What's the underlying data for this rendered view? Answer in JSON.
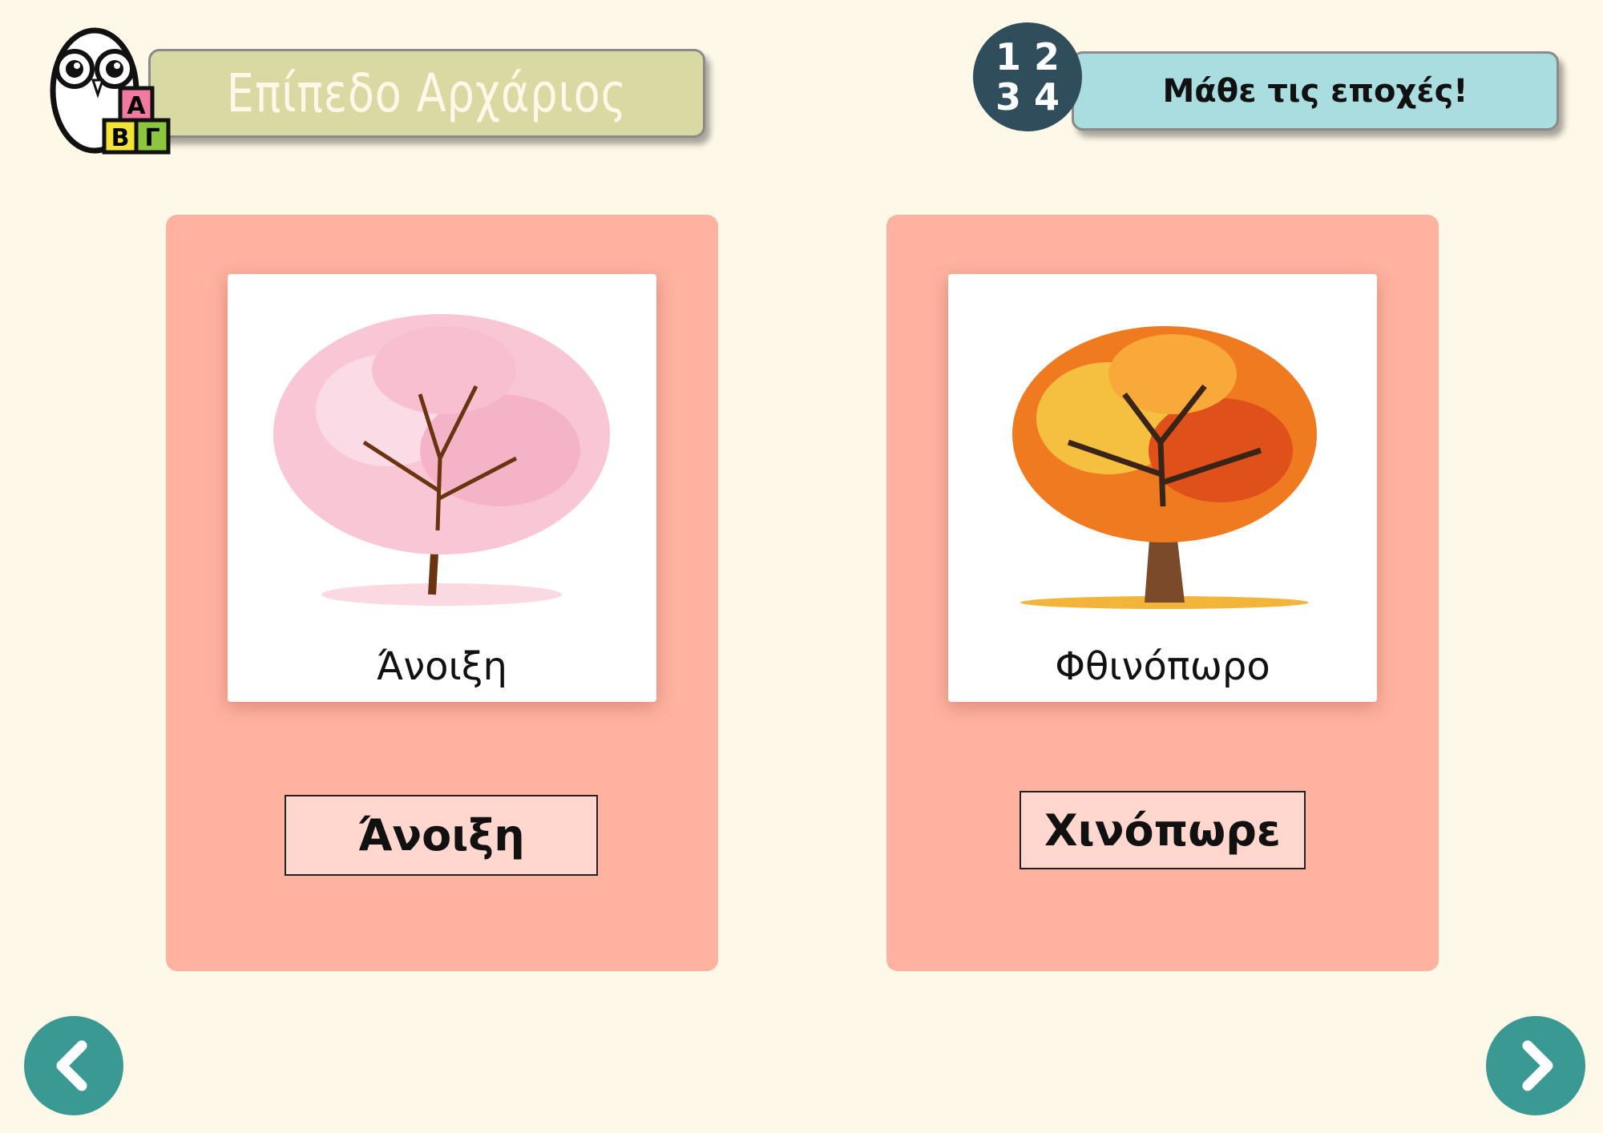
{
  "header": {
    "level_label": "Επίπεδο Αρχάριος",
    "logo_letters": [
      "A",
      "B",
      "Γ"
    ],
    "number_badge": [
      "1 2",
      "3 4"
    ],
    "activity_title": "Μάθε τις εποχές!"
  },
  "cards": [
    {
      "image": "cherry-blossom-tree",
      "image_label": "Άνοιξη",
      "answer": "Άνοιξη"
    },
    {
      "image": "autumn-tree",
      "image_label": "Φθινόπωρο",
      "answer": "Χινόπωρε"
    }
  ],
  "nav": {
    "prev_icon": "chevron-left-icon",
    "next_icon": "chevron-right-icon"
  },
  "colors": {
    "background": "#fef8e8",
    "card": "#ffb2a0",
    "answer_box": "#ffd7cf",
    "nav": "#3a9a93",
    "level_banner": "#d9d9a3",
    "title_banner": "#aadde0",
    "badge": "#2f4d5a"
  }
}
